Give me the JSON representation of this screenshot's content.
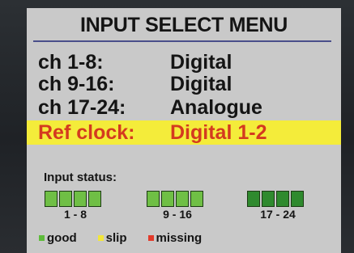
{
  "menu": {
    "title": "INPUT SELECT MENU",
    "rows": [
      {
        "label": "ch 1-8:",
        "value": "Digital"
      },
      {
        "label": "ch 9-16:",
        "value": "Digital"
      },
      {
        "label": "ch 17-24:",
        "value": "Analogue"
      },
      {
        "label": "Ref clock:",
        "value": "Digital 1-2"
      }
    ],
    "highlight_bg": "#f4ec3a",
    "highlight_text": "#d43a1f"
  },
  "status": {
    "title": "Input status:",
    "groups": [
      {
        "label": "1 - 8",
        "state": "good",
        "count": 4
      },
      {
        "label": "9 - 16",
        "state": "good",
        "count": 4
      },
      {
        "label": "17 - 24",
        "state": "good-dark",
        "count": 4
      }
    ],
    "legend": [
      {
        "label": "good",
        "color": "#5dbb3a"
      },
      {
        "label": "slip",
        "color": "#f2e63a"
      },
      {
        "label": "missing",
        "color": "#e23a2a"
      }
    ],
    "colors": {
      "good": "#6fbf45",
      "good-dark": "#2f8a2e"
    }
  }
}
